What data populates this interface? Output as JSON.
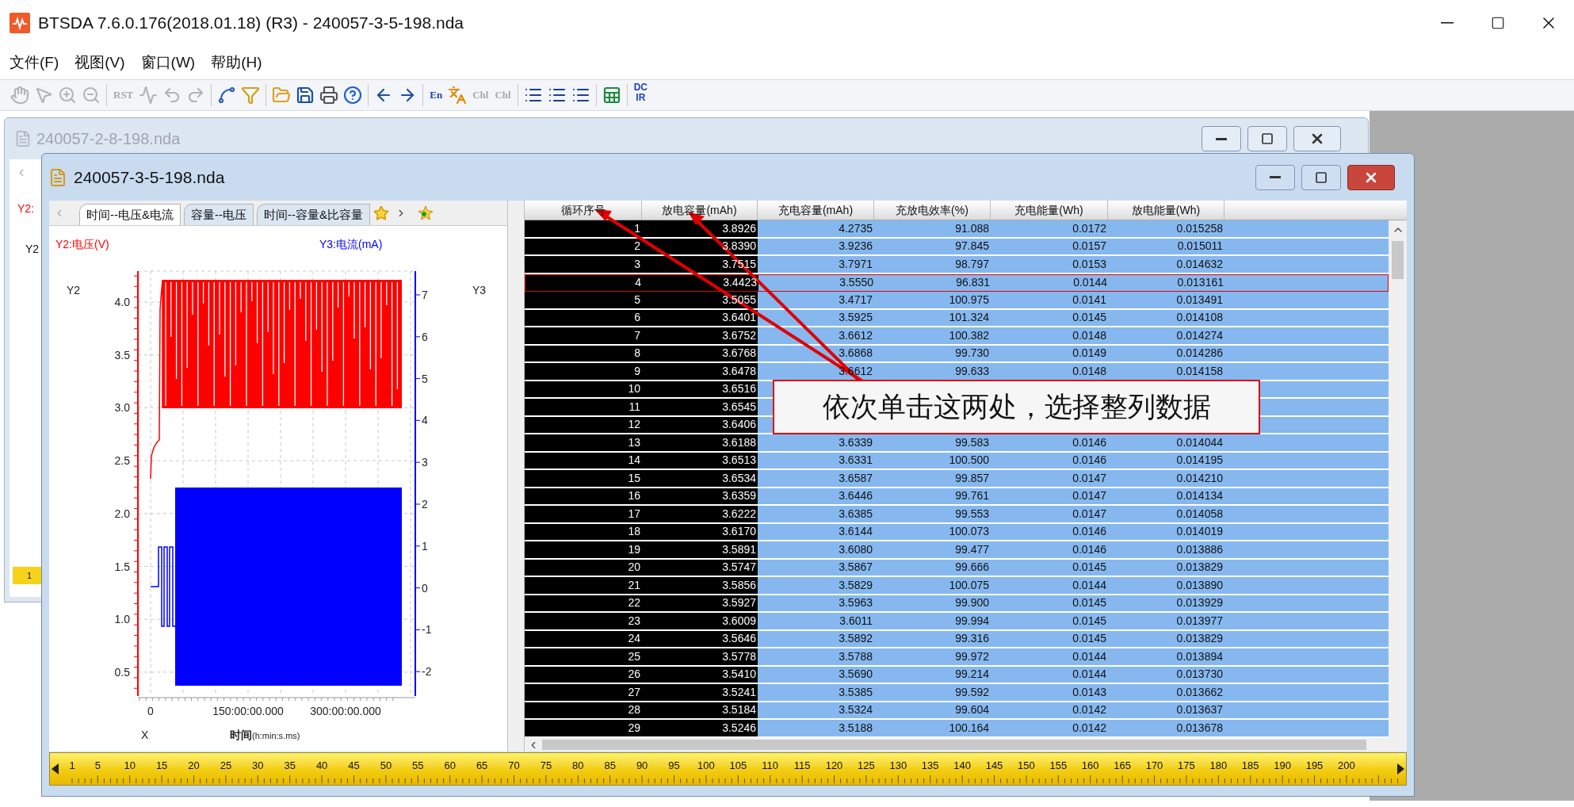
{
  "app": {
    "title": "BTSDA 7.6.0.176(2018.01.18) (R3) - 240057-3-5-198.nda"
  },
  "menu": [
    "文件(F)",
    "视图(V)",
    "窗口(W)",
    "帮助(H)"
  ],
  "toolbar": [
    {
      "kind": "hand",
      "disabled": true
    },
    {
      "kind": "pointer",
      "disabled": true
    },
    {
      "kind": "zoom-in",
      "disabled": true
    },
    {
      "kind": "zoom-out",
      "disabled": true
    },
    {
      "kind": "sep"
    },
    {
      "kind": "text",
      "label": "RST",
      "disabled": true
    },
    {
      "kind": "wave",
      "disabled": true
    },
    {
      "kind": "undo",
      "disabled": true
    },
    {
      "kind": "redo",
      "disabled": true
    },
    {
      "kind": "sep"
    },
    {
      "kind": "line",
      "disabled": false
    },
    {
      "kind": "filter",
      "disabled": false
    },
    {
      "kind": "sep"
    },
    {
      "kind": "open",
      "disabled": false
    },
    {
      "kind": "save",
      "disabled": false
    },
    {
      "kind": "print",
      "disabled": false
    },
    {
      "kind": "help",
      "disabled": false
    },
    {
      "kind": "sep"
    },
    {
      "kind": "back",
      "disabled": false
    },
    {
      "kind": "forward",
      "disabled": false
    },
    {
      "kind": "sep"
    },
    {
      "kind": "text",
      "label": "En",
      "disabled": false
    },
    {
      "kind": "pin",
      "disabled": false
    },
    {
      "kind": "text",
      "label": "Chl",
      "disabled": true
    },
    {
      "kind": "text",
      "label": "Chl",
      "disabled": true
    },
    {
      "kind": "sep"
    },
    {
      "kind": "list",
      "disabled": false
    },
    {
      "kind": "list",
      "disabled": false
    },
    {
      "kind": "list",
      "disabled": false
    },
    {
      "kind": "sep"
    },
    {
      "kind": "excel",
      "disabled": false
    },
    {
      "kind": "sep"
    },
    {
      "kind": "stack",
      "labels": [
        "DC",
        "IR"
      ],
      "disabled": false
    }
  ],
  "back_window": {
    "title": "240057-2-8-198.nda",
    "axis_title": "Y2:",
    "axis": "Y2",
    "ruler_start": "1"
  },
  "window": {
    "title": "240057-3-5-198.nda",
    "chart_tabs": [
      {
        "label": "时间--电压&电流",
        "selected": true
      },
      {
        "label": "容量--电压",
        "selected": false
      },
      {
        "label": "时间--容量&比容量",
        "selected": false
      }
    ],
    "chart": {
      "y2_title": "Y2:电压(V)",
      "y3_title": "Y3:电流(mA)",
      "y2_axis": "Y2",
      "y3_axis": "Y3",
      "x_axis": "X",
      "xlabel": "时间",
      "xunit": "(h:min:s.ms)",
      "y2_ticks": [
        "4.0",
        "3.5",
        "3.0",
        "2.5",
        "2.0",
        "1.5",
        "1.0",
        "0.5"
      ],
      "y3_ticks": [
        "7",
        "6",
        "5",
        "4",
        "3",
        "2",
        "1",
        "0",
        "-1",
        "-2"
      ],
      "x_ticks": [
        "0",
        "150:00:00.000",
        "300:00:00.000"
      ]
    },
    "table": {
      "columns": [
        {
          "label": "循环序号",
          "selected": true
        },
        {
          "label": "放电容量(mAh)",
          "selected": true
        },
        {
          "label": "充电容量(mAh)",
          "selected": false
        },
        {
          "label": "充放电效率(%)",
          "selected": false
        },
        {
          "label": "充电能量(Wh)",
          "selected": false
        },
        {
          "label": "放电能量(Wh)",
          "selected": false
        }
      ],
      "rows": [
        {
          "cells": [
            "1",
            "3.8926",
            "4.2735",
            "91.088",
            "0.0172",
            "0.015258"
          ],
          "focused": false
        },
        {
          "cells": [
            "2",
            "3.8390",
            "3.9236",
            "97.845",
            "0.0157",
            "0.015011"
          ],
          "focused": false
        },
        {
          "cells": [
            "3",
            "3.7515",
            "3.7971",
            "98.797",
            "0.0153",
            "0.014632"
          ],
          "focused": false
        },
        {
          "cells": [
            "4",
            "3.4423",
            "3.5550",
            "96.831",
            "0.0144",
            "0.013161"
          ],
          "focused": true
        },
        {
          "cells": [
            "5",
            "3.5055",
            "3.4717",
            "100.975",
            "0.0141",
            "0.013491"
          ],
          "focused": false
        },
        {
          "cells": [
            "6",
            "3.6401",
            "3.5925",
            "101.324",
            "0.0145",
            "0.014108"
          ],
          "focused": false
        },
        {
          "cells": [
            "7",
            "3.6752",
            "3.6612",
            "100.382",
            "0.0148",
            "0.014274"
          ],
          "focused": false
        },
        {
          "cells": [
            "8",
            "3.6768",
            "3.6868",
            "99.730",
            "0.0149",
            "0.014286"
          ],
          "focused": false
        },
        {
          "cells": [
            "9",
            "3.6478",
            "3.6612",
            "99.633",
            "0.0148",
            "0.014158"
          ],
          "focused": false
        },
        {
          "cells": [
            "10",
            "3.6516"
          ],
          "focused": false
        },
        {
          "cells": [
            "11",
            "3.6545"
          ],
          "focused": false
        },
        {
          "cells": [
            "12",
            "3.6406"
          ],
          "focused": false
        },
        {
          "cells": [
            "13",
            "3.6188",
            "3.6339",
            "99.583",
            "0.0146",
            "0.014044"
          ],
          "focused": false
        },
        {
          "cells": [
            "14",
            "3.6513",
            "3.6331",
            "100.500",
            "0.0146",
            "0.014195"
          ],
          "focused": false
        },
        {
          "cells": [
            "15",
            "3.6534",
            "3.6587",
            "99.857",
            "0.0147",
            "0.014210"
          ],
          "focused": false
        },
        {
          "cells": [
            "16",
            "3.6359",
            "3.6446",
            "99.761",
            "0.0147",
            "0.014134"
          ],
          "focused": false
        },
        {
          "cells": [
            "17",
            "3.6222",
            "3.6385",
            "99.553",
            "0.0147",
            "0.014058"
          ],
          "focused": false
        },
        {
          "cells": [
            "18",
            "3.6170",
            "3.6144",
            "100.073",
            "0.0146",
            "0.014019"
          ],
          "focused": false
        },
        {
          "cells": [
            "19",
            "3.5891",
            "3.6080",
            "99.477",
            "0.0146",
            "0.013886"
          ],
          "focused": false
        },
        {
          "cells": [
            "20",
            "3.5747",
            "3.5867",
            "99.666",
            "0.0145",
            "0.013829"
          ],
          "focused": false
        },
        {
          "cells": [
            "21",
            "3.5856",
            "3.5829",
            "100.075",
            "0.0144",
            "0.013890"
          ],
          "focused": false
        },
        {
          "cells": [
            "22",
            "3.5927",
            "3.5963",
            "99.900",
            "0.0145",
            "0.013929"
          ],
          "focused": false
        },
        {
          "cells": [
            "23",
            "3.6009",
            "3.6011",
            "99.994",
            "0.0145",
            "0.013977"
          ],
          "focused": false
        },
        {
          "cells": [
            "24",
            "3.5646",
            "3.5892",
            "99.316",
            "0.0145",
            "0.013829"
          ],
          "focused": false
        },
        {
          "cells": [
            "25",
            "3.5778",
            "3.5788",
            "99.972",
            "0.0144",
            "0.013894"
          ],
          "focused": false
        },
        {
          "cells": [
            "26",
            "3.5410",
            "3.5690",
            "99.214",
            "0.0144",
            "0.013730"
          ],
          "focused": false
        },
        {
          "cells": [
            "27",
            "3.5241",
            "3.5385",
            "99.592",
            "0.0143",
            "0.013662"
          ],
          "focused": false
        },
        {
          "cells": [
            "28",
            "3.5184",
            "3.5324",
            "99.604",
            "0.0142",
            "0.013637"
          ],
          "focused": false
        },
        {
          "cells": [
            "29",
            "3.5246",
            "3.5188",
            "100.164",
            "0.0142",
            "0.013678"
          ],
          "focused": false
        }
      ]
    },
    "ruler": [
      "1",
      "5",
      "10",
      "15",
      "20",
      "25",
      "30",
      "35",
      "40",
      "45",
      "50",
      "55",
      "60",
      "65",
      "70",
      "75",
      "80",
      "85",
      "90",
      "95",
      "100",
      "105",
      "110",
      "115",
      "120",
      "125",
      "130",
      "135",
      "140",
      "145",
      "150",
      "155",
      "160",
      "165",
      "170",
      "175",
      "180",
      "185",
      "190",
      "195",
      "200"
    ]
  },
  "annotation": {
    "text": "依次单击这两处，选择整列数据"
  }
}
